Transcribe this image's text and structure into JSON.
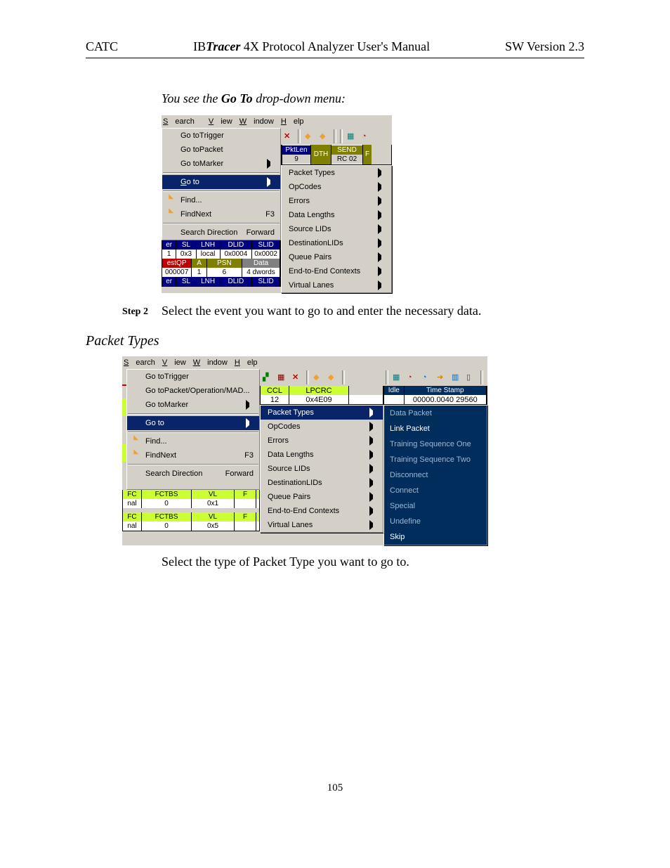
{
  "header": {
    "left": "CATC",
    "center_prefix": "IB",
    "center_bold": "Tracer",
    "center_rest": " 4X Protocol Analyzer User's Manual",
    "right": "SW Version 2.3"
  },
  "intro": {
    "prefix": "You see the ",
    "bold": "Go To",
    "suffix": " drop-down menu:"
  },
  "step2": {
    "label": "Step 2",
    "text": "Select the event you want to go to and enter the necessary data."
  },
  "section_title": "Packet Types",
  "select_line": "Select the type of Packet Type  you want to go to.",
  "page_number": "105",
  "menubar": {
    "search": "Search",
    "view": "View",
    "window": "Window",
    "help": "Help"
  },
  "menu1": {
    "go_to_trigger": "Go to Trigger",
    "go_to_packet": "Go to Packet",
    "go_to_marker": "Go to Marker",
    "go_to": "Go to",
    "find": "Find...",
    "find_next": "Find Next",
    "find_next_key": "F3",
    "search_direction": "Search Direction",
    "forward": "Forward"
  },
  "menu1_sub": {
    "packet_types": "Packet Types",
    "opcodes": "OpCodes",
    "errors": "Errors",
    "data_lengths": "Data Lengths",
    "source_lids": "Source LIDs",
    "destination_lids": "Destination LIDs",
    "queue_pairs": "Queue Pairs",
    "end_to_end": "End-to-End Contexts",
    "virtual_lanes": "Virtual Lanes"
  },
  "pkt1": {
    "pktlen_label": "PktLen",
    "pktlen_val": "9",
    "dth": "DTH",
    "send": "SEND",
    "rc02": "RC 02",
    "f": "F"
  },
  "grid1": {
    "h_er": "er",
    "h_sl": "SL",
    "h_lnh": "LNH",
    "h_dlid": "DLID",
    "h_slid": "SLID",
    "r1_1": "1",
    "r1_0x3": "0x3",
    "r1_local": "local",
    "r1_0x0004": "0x0004",
    "r1_0x0002": "0x0002",
    "h2_est": "estQP",
    "h2_a": "A",
    "h2_psn": "PSN",
    "h2_data": "Data",
    "r2_007": "000007",
    "r2_1": "1",
    "r2_6": "6",
    "r2_4dw": "4 dwords",
    "h3_er": "er",
    "h3_sl": "SL",
    "h3_lnh": "LNH",
    "h3_dlid": "DLID",
    "h3_slid": "SLID"
  },
  "menu2": {
    "go_to_trigger": "Go to Trigger",
    "go_to_pom": "Go to Packet/Operation/MAD...",
    "go_to_marker": "Go to Marker",
    "go_to": "Go to",
    "find": "Find...",
    "find_next": "Find Next",
    "find_next_key": "F3",
    "search_direction": "Search Direction",
    "forward": "Forward"
  },
  "hdr2": {
    "ccl": "CCL",
    "lpcrc": "LPCRC",
    "lpcrc_val": "0x4E09",
    "idle": "Idle",
    "ts": "Time Stamp",
    "ts_val": "00000.0040 29560",
    "ccl_12": "12"
  },
  "tertiary": {
    "data_packet": "Data Packet",
    "link_packet": "Link Packet",
    "tso": "Training Sequence One",
    "tst": "Training Sequence Two",
    "disconnect": "Disconnect",
    "connect": "Connect",
    "special": "Special",
    "undefine": "Undefine",
    "skip": "Skip"
  },
  "grid2": {
    "h_fc": "FC",
    "h_fctbs": "FCTBS",
    "h_vl": "VL",
    "h_f": "F",
    "r_nal": "nal",
    "r_0": "0",
    "r_0x1": "0x1",
    "r_0x5": "0x5"
  }
}
